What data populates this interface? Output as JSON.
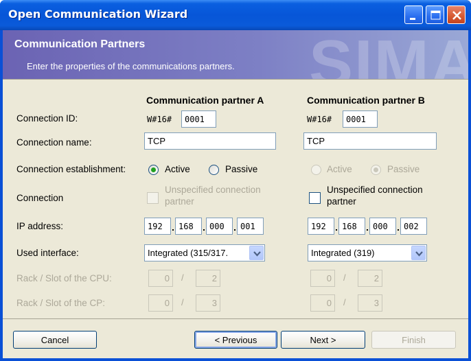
{
  "window": {
    "title": "Open Communication Wizard",
    "buttons": {
      "minimize": "minimize-icon",
      "maximize": "maximize-icon",
      "close": "close-icon"
    }
  },
  "banner": {
    "title": "Communication Partners",
    "subtitle": "Enter the properties of the communications partners.",
    "background_text": "SIMA"
  },
  "columns": {
    "a_heading": "Communication partner A",
    "b_heading": "Communication partner B"
  },
  "labels": {
    "connection_id": "Connection ID:",
    "connection_name": "Connection name:",
    "connection_establishment": "Connection establishment:",
    "connection": "Connection",
    "ip_address": "IP address:",
    "used_interface": "Used interface:",
    "rack_slot_cpu": "Rack / Slot of the  CPU:",
    "rack_slot_cp": "Rack / Slot of the CP:"
  },
  "partner_a": {
    "id_prefix": "W#16#",
    "id_value": "0001",
    "name": "TCP",
    "radio_active": "Active",
    "radio_passive": "Passive",
    "selected": "Active",
    "unspecified_label_1": "Unspecified connection",
    "unspecified_label_2": "partner",
    "unspecified_checked": false,
    "unspecified_enabled": false,
    "ip": [
      "192",
      "168",
      "000",
      "001"
    ],
    "interface": "Integrated (315/317.",
    "cpu_rack": "0",
    "cpu_slot": "2",
    "cp_rack": "0",
    "cp_slot": "3"
  },
  "partner_b": {
    "id_prefix": "W#16#",
    "id_value": "0001",
    "name": "TCP",
    "radio_active": "Active",
    "radio_passive": "Passive",
    "selected": "Passive",
    "radios_enabled": false,
    "unspecified_label_1": "Unspecified connection",
    "unspecified_label_2": "partner",
    "unspecified_checked": false,
    "unspecified_enabled": true,
    "ip": [
      "192",
      "168",
      "000",
      "002"
    ],
    "interface": "Integrated (319)",
    "cpu_rack": "0",
    "cpu_slot": "2",
    "cp_rack": "0",
    "cp_slot": "3"
  },
  "footer": {
    "cancel": "Cancel",
    "previous": "< Previous",
    "next": "Next >",
    "finish": "Finish"
  },
  "colors": {
    "titlebar": "#0a5ad9",
    "banner": "#7d80c5",
    "dialog_bg": "#ece9d8",
    "radio_selected": "#21a121",
    "disabled_text": "#aca899"
  }
}
